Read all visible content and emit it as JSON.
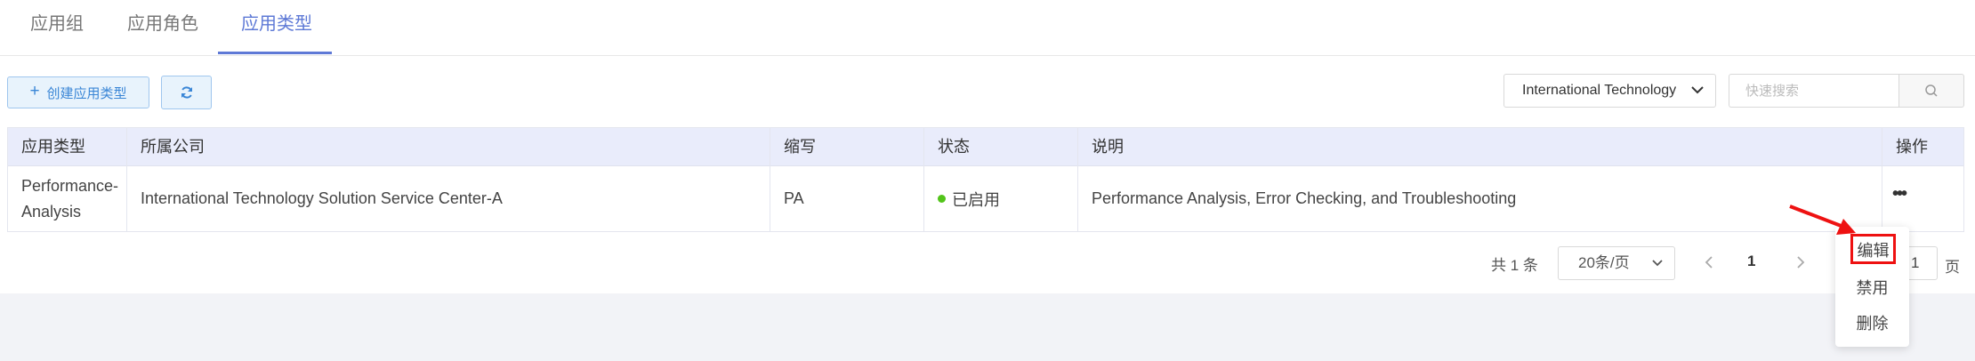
{
  "tabs": [
    {
      "label": "应用组",
      "active": false
    },
    {
      "label": "应用角色",
      "active": false
    },
    {
      "label": "应用类型",
      "active": true
    }
  ],
  "toolbar": {
    "create_label": "创建应用类型",
    "company_select": "International Technology Solution Service Center-A",
    "search_placeholder": "快速搜索"
  },
  "table": {
    "headers": [
      "应用类型",
      "所属公司",
      "缩写",
      "状态",
      "说明",
      "操作"
    ],
    "rows": [
      {
        "type": "Performance-Analysis",
        "company": "International Technology Solution Service Center-A",
        "abbr": "PA",
        "status": "已启用",
        "description": "Performance Analysis, Error Checking, and Troubleshooting",
        "action": "•••"
      }
    ]
  },
  "pagination": {
    "total": "共 1 条",
    "page_size": "20条/页",
    "current": "1",
    "jump_value": "1",
    "page_label": "页"
  },
  "action_menu": {
    "items": [
      "编辑",
      "禁用",
      "删除"
    ]
  },
  "colors": {
    "accent": "#5e79d6",
    "button_bg": "#e8f3fc",
    "button_border": "#9fc6ee",
    "header_bg": "#e9ecfb",
    "status_green": "#52c41a",
    "annotation_red": "#ee1111"
  }
}
